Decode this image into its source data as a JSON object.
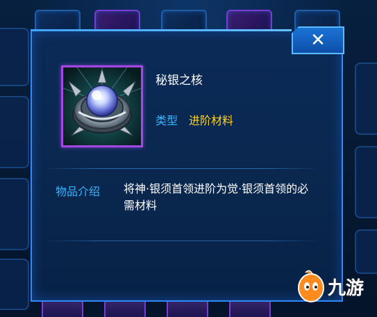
{
  "item": {
    "name": "秘银之核",
    "type_label": "类型",
    "type_value": "进阶材料",
    "rarity_color": "#a646e6",
    "icon": "mithril-core-icon"
  },
  "description": {
    "label": "物品介绍",
    "text": "将神·银须首领进阶为觉·银须首领的必需材料"
  },
  "dialog": {
    "close_icon": "close-icon",
    "accent_color": "#2f8bff"
  },
  "watermark": {
    "text": "九游",
    "icon": "jiuyou-mascot-icon"
  }
}
